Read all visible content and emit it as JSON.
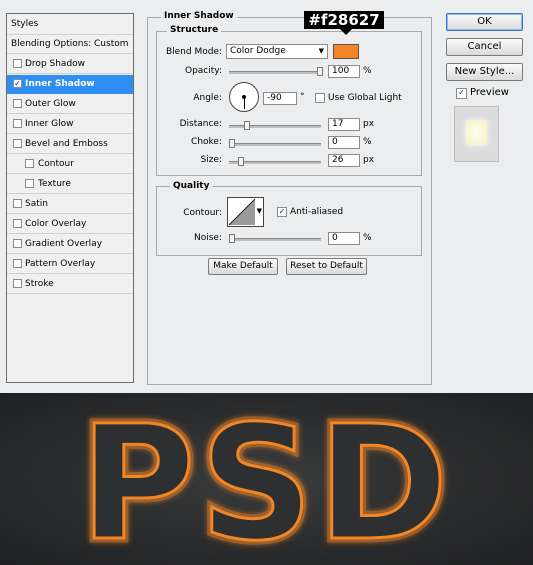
{
  "styles_panel": {
    "header": "Styles",
    "items": [
      {
        "label": "Blending Options: Custom",
        "type": "header"
      },
      {
        "label": "Drop Shadow",
        "checked": false
      },
      {
        "label": "Inner Shadow",
        "checked": true,
        "selected": true
      },
      {
        "label": "Outer Glow",
        "checked": false
      },
      {
        "label": "Inner Glow",
        "checked": false
      },
      {
        "label": "Bevel and Emboss",
        "checked": false
      },
      {
        "label": "Contour",
        "checked": false,
        "sub": true
      },
      {
        "label": "Texture",
        "checked": false,
        "sub": true
      },
      {
        "label": "Satin",
        "checked": false
      },
      {
        "label": "Color Overlay",
        "checked": false
      },
      {
        "label": "Gradient Overlay",
        "checked": false
      },
      {
        "label": "Pattern Overlay",
        "checked": false
      },
      {
        "label": "Stroke",
        "checked": false
      }
    ]
  },
  "inner_shadow": {
    "title": "Inner Shadow",
    "color_callout": "#f28627",
    "structure": {
      "title": "Structure",
      "blend_mode_label": "Blend Mode:",
      "blend_mode_value": "Color Dodge",
      "color": "#f28627",
      "opacity_label": "Opacity:",
      "opacity_value": "100",
      "opacity_level": 1.0,
      "angle_label": "Angle:",
      "angle_value": "-90",
      "angle_unit": "°",
      "use_global_light_label": "Use Global Light",
      "use_global_light_checked": false,
      "distance_label": "Distance:",
      "distance_value": "17",
      "distance_level": 0.17,
      "choke_label": "Choke:",
      "choke_value": "0",
      "choke_level": 0,
      "size_label": "Size:",
      "size_value": "26",
      "size_level": 0.104,
      "unit_percent": "%",
      "unit_px": "px"
    },
    "quality": {
      "title": "Quality",
      "contour_label": "Contour:",
      "anti_aliased_label": "Anti-aliased",
      "anti_aliased_checked": true,
      "noise_label": "Noise:",
      "noise_value": "0",
      "noise_level": 0,
      "unit_percent": "%"
    },
    "make_default_label": "Make Default",
    "reset_default_label": "Reset to Default"
  },
  "actions": {
    "ok_label": "OK",
    "cancel_label": "Cancel",
    "new_style_label": "New Style...",
    "preview_label": "Preview",
    "preview_checked": true
  },
  "banner": {
    "text": "PSD",
    "glow_color": "#f28627",
    "fill_color": "#2e2f30"
  }
}
